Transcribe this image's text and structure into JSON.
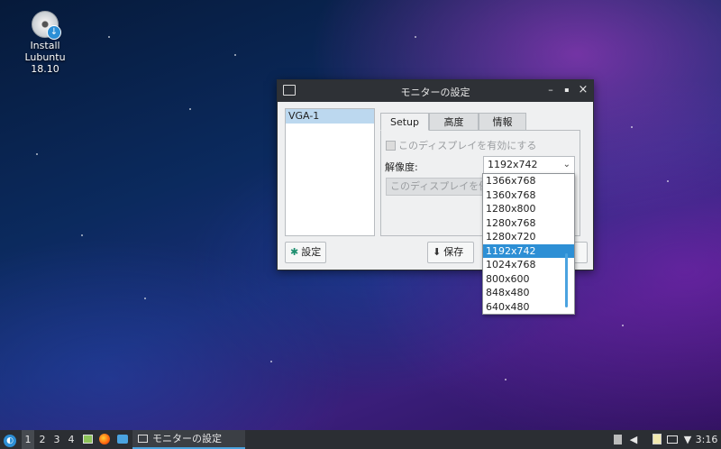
{
  "desktop": {
    "icon_label": "Install Lubuntu\n18.10",
    "icon_line1": "Install Lubuntu",
    "icon_line2": "18.10"
  },
  "window": {
    "title": "モニターの設定",
    "controls": {
      "minimize": "–",
      "restore": "▪",
      "close": "×"
    },
    "outputs": [
      "VGA-1"
    ],
    "tabs": [
      "Setup",
      "高度",
      "情報"
    ],
    "active_tab": "Setup",
    "enable_checkbox_label": "このディスプレイを有効にする",
    "resolution_label": "解像度:",
    "resolution_value": "1192x742",
    "primary_button_label": "このディスプレイを優先",
    "settings_button_label": "設定",
    "save_button_label": "保存"
  },
  "dropdown": {
    "options": [
      "1366x768",
      "1360x768",
      "1280x800",
      "1280x768",
      "1280x720",
      "1192x742",
      "1024x768",
      "800x600",
      "848x480",
      "640x480"
    ],
    "selected": "1192x742"
  },
  "taskbar": {
    "workspaces": [
      "1",
      "2",
      "3",
      "4"
    ],
    "active_workspace": "1",
    "task_label": "モニターの設定",
    "clock": "3:16"
  },
  "colors": {
    "accent": "#2d8fd5",
    "titlebar": "#2e3136",
    "taskbar": "#2b2e33",
    "window_bg": "#eff0f1"
  }
}
